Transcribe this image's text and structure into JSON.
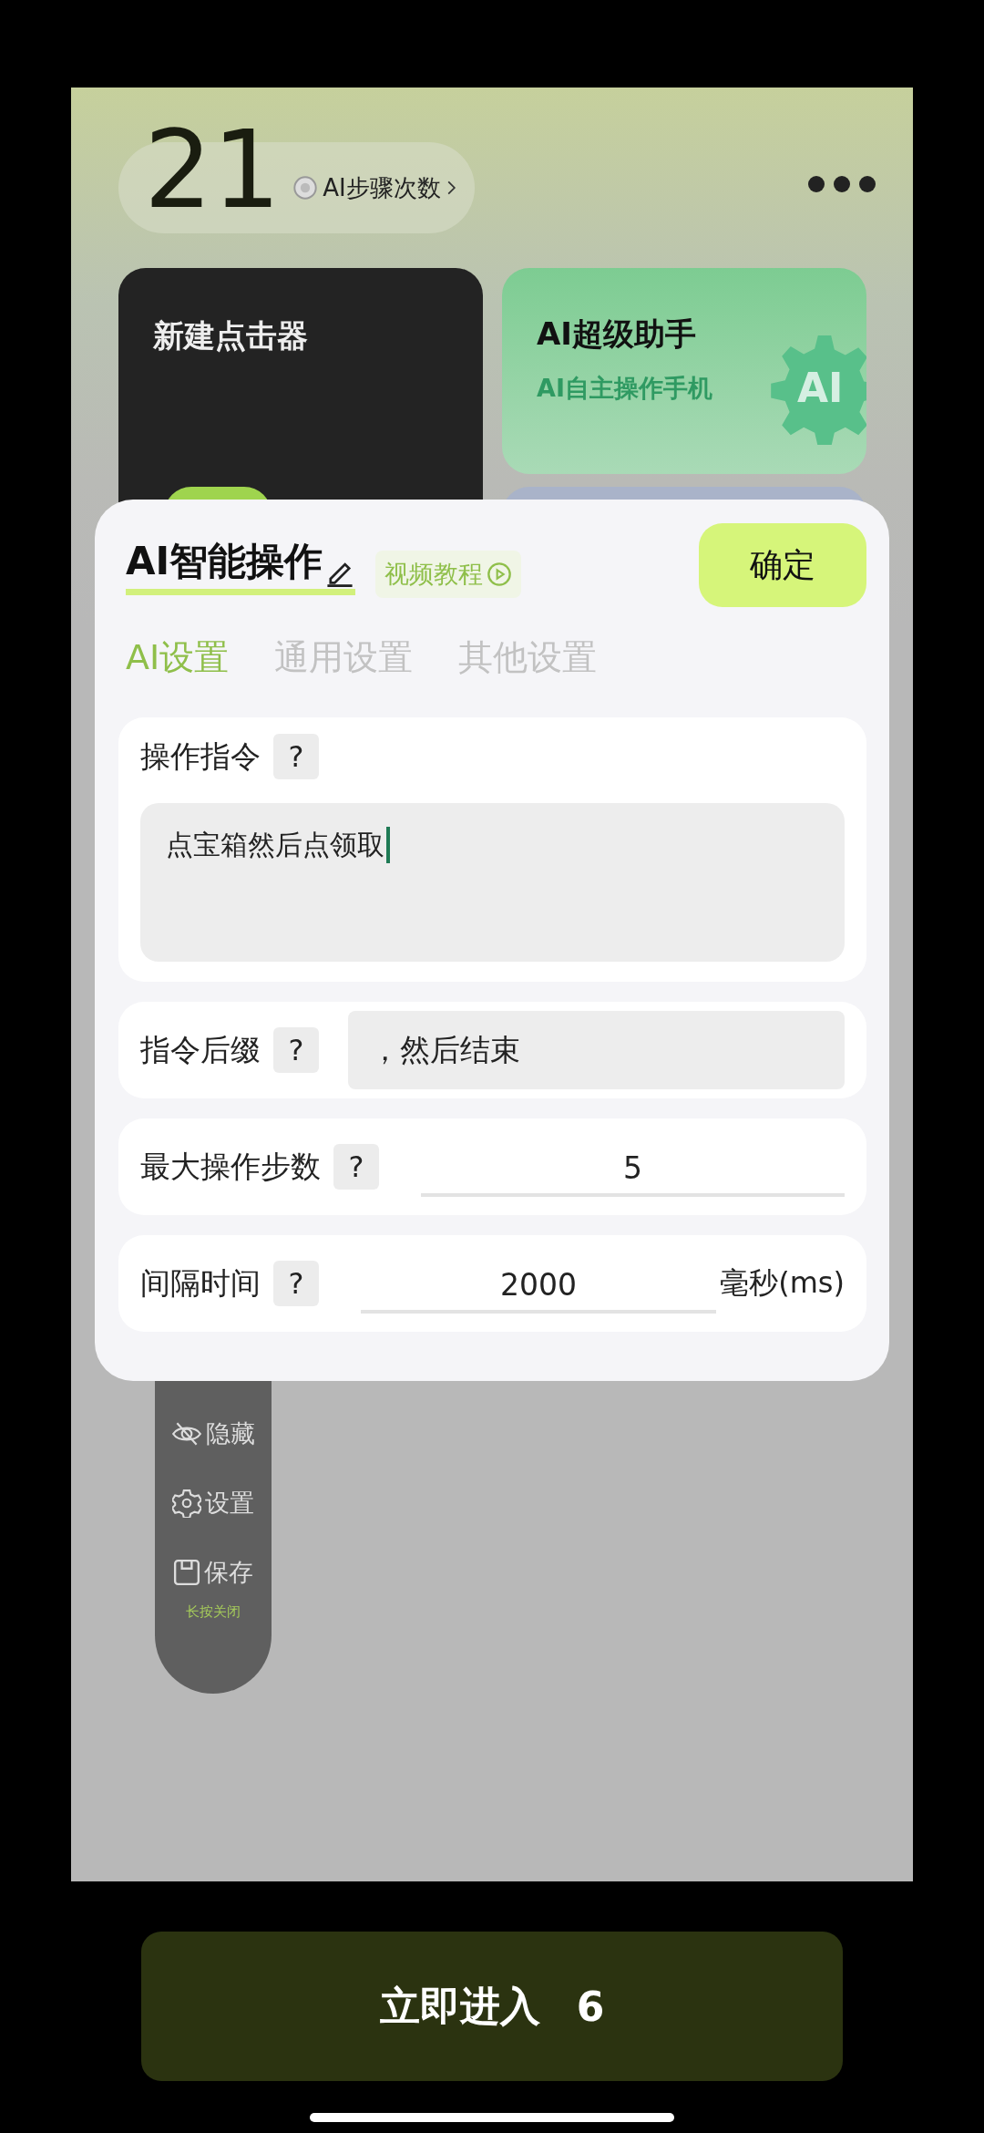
{
  "header": {
    "count": "21",
    "counter_label": "AI步骤次数"
  },
  "cards": [
    {
      "kind": "dark",
      "title": "新建点击器"
    },
    {
      "kind": "green",
      "title": "AI超级助手",
      "subtitle": "AI自主操作手机",
      "badge": "AI"
    }
  ],
  "dialog": {
    "title": "AI智能操作",
    "tutorial": "视频教程",
    "confirm": "确定",
    "tabs": [
      {
        "label": "AI设置",
        "selected": true
      },
      {
        "label": "通用设置",
        "selected": false
      },
      {
        "label": "其他设置",
        "selected": false
      }
    ],
    "fields": [
      {
        "kind": "textarea",
        "label": "操作指令",
        "help": "?",
        "value": "点宝箱然后点领取",
        "focused": true
      },
      {
        "kind": "text",
        "label": "指令后缀",
        "help": "?",
        "value": "，然后结束",
        "focused": false
      },
      {
        "kind": "number",
        "label": "最大操作步数",
        "help": "?",
        "value": "5",
        "focused": false
      },
      {
        "kind": "number",
        "label": "间隔时间",
        "help": "?",
        "value": "2000",
        "unit": "毫秒(ms)",
        "focused": false
      }
    ]
  },
  "floating_menu": {
    "items": [
      {
        "kind": "hide",
        "label": "隐藏"
      },
      {
        "kind": "settings",
        "label": "设置"
      },
      {
        "kind": "save",
        "label": "保存"
      }
    ],
    "hint": "长按关闭"
  },
  "enter_button": {
    "label": "立即进入",
    "countdown": "6"
  }
}
